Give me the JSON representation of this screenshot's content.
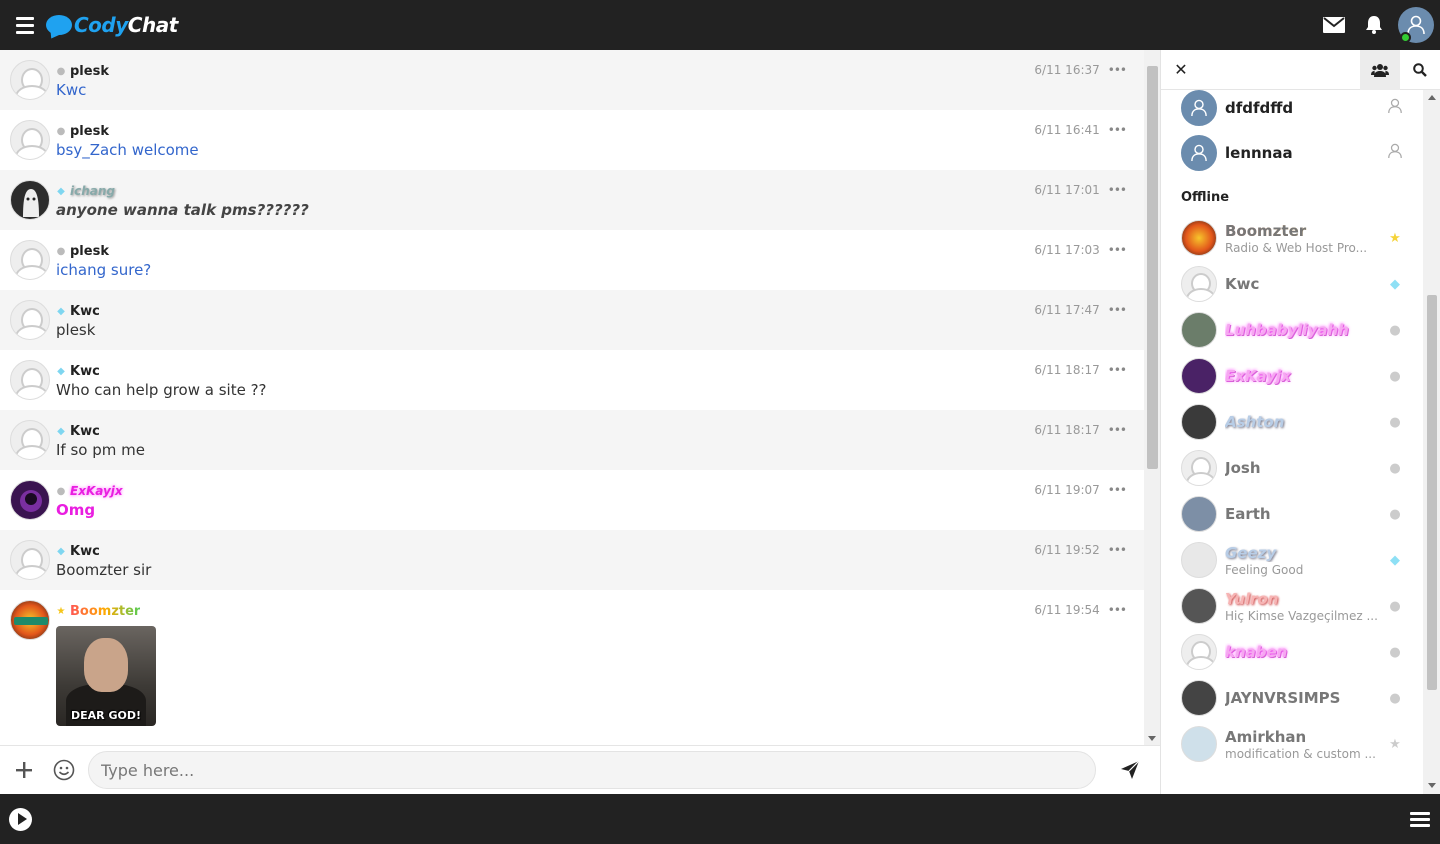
{
  "app": {
    "logo_part1": "Cody",
    "logo_part2": "Chat"
  },
  "input": {
    "placeholder": "Type here..."
  },
  "messages": [
    {
      "user": "plesk",
      "time": "6/11 16:37",
      "text": "Kwc"
    },
    {
      "user": "plesk",
      "time": "6/11 16:41",
      "text": "bsy_Zach welcome"
    },
    {
      "user": "ichang",
      "time": "6/11 17:01",
      "text": "anyone wanna talk pms??????"
    },
    {
      "user": "plesk",
      "time": "6/11 17:03",
      "text": "ichang sure?"
    },
    {
      "user": "Kwc",
      "time": "6/11 17:47",
      "text": "plesk"
    },
    {
      "user": "Kwc",
      "time": "6/11 18:17",
      "text": "Who can help grow a site ??"
    },
    {
      "user": "Kwc",
      "time": "6/11 18:17",
      "text": "If so pm me"
    },
    {
      "user": "ExKayjx",
      "time": "6/11 19:07",
      "text": "Omg"
    },
    {
      "user": "Kwc",
      "time": "6/11 19:52",
      "text": "Boomzter sir"
    },
    {
      "user": "Boomzter",
      "time": "6/11 19:54",
      "gif_caption": "DEAR GOD!"
    }
  ],
  "panel": {
    "online": [
      {
        "name": "dfdfdffd"
      },
      {
        "name": "lennnaa"
      }
    ],
    "offline_title": "Offline",
    "offline": [
      {
        "name": "Boomzter",
        "mood": "Radio & Web Host Pro..."
      },
      {
        "name": "Kwc",
        "mood": ""
      },
      {
        "name": "Luhbabyliyahh",
        "mood": ""
      },
      {
        "name": "ExKayjx",
        "mood": ""
      },
      {
        "name": "Ashton",
        "mood": ""
      },
      {
        "name": "Josh",
        "mood": ""
      },
      {
        "name": "Earth",
        "mood": ""
      },
      {
        "name": "Geezy",
        "mood": "Feeling Good"
      },
      {
        "name": "Yulron",
        "mood": "Hiç Kimse Vazgeçilmez ..."
      },
      {
        "name": "knaben",
        "mood": ""
      },
      {
        "name": "JAYNVRSIMPS",
        "mood": ""
      },
      {
        "name": "Amirkhan",
        "mood": "modification & custom ..."
      }
    ]
  },
  "colors": {
    "topbar": "#222222",
    "accent": "#1fa2f0",
    "link_blue": "#3366cc",
    "pink": "#e91ee0"
  },
  "icons": [
    "menu-icon",
    "envelope-icon",
    "bell-icon",
    "user-avatar-icon",
    "close-icon",
    "users-icon",
    "search-icon",
    "plus-icon",
    "smiley-icon",
    "send-icon",
    "play-icon",
    "menu-lines-icon"
  ]
}
